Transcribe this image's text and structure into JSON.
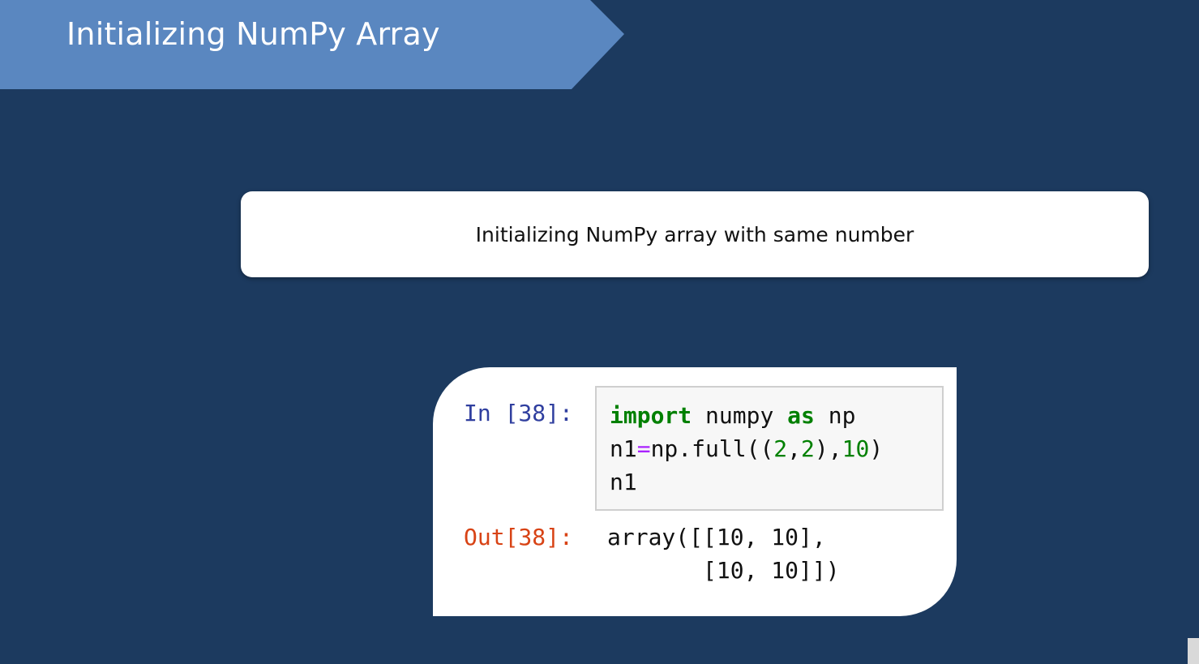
{
  "slide": {
    "title": "Initializing NumPy Array",
    "subtitle": "Initializing NumPy array with same number"
  },
  "notebook": {
    "in_prompt": "In [38]:",
    "out_prompt": "Out[38]:",
    "code": {
      "line1": {
        "kw1": "import",
        "mid": " numpy ",
        "kw2": "as",
        "end": " np"
      },
      "line2": {
        "a": "n1",
        "eq": "=",
        "b": "np.full((",
        "n1": "2",
        "c": ",",
        "n2": "2",
        "d": "),",
        "n3": "10",
        "e": ")"
      },
      "line3": "n1"
    },
    "output": {
      "line1": "array([[10, 10],",
      "line2": "       [10, 10]])"
    }
  },
  "colors": {
    "background": "#1c3a5f",
    "banner": "#5a87c0",
    "keyword": "#008000",
    "in_prompt": "#303f9f",
    "out_prompt": "#d84315"
  }
}
